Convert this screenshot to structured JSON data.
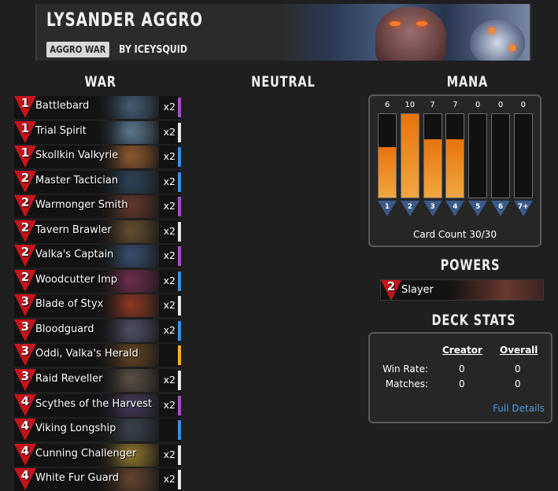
{
  "header": {
    "title": "LYSANDER AGGRO",
    "tag": "AGGRO WAR",
    "author": "BY ICEYSQUID"
  },
  "sections": {
    "war": "WAR",
    "neutral": "NEUTRAL",
    "mana": "MANA",
    "powers": "POWERS",
    "deck_stats": "DECK STATS"
  },
  "cards": [
    {
      "cost": "1",
      "name": "Battlebard",
      "count": "x2",
      "rarity_color": "#a64fc4",
      "art_color": "#5b7fa0"
    },
    {
      "cost": "1",
      "name": "Trial Spirit",
      "count": "x2",
      "rarity_color": "#e8e8e8",
      "art_color": "#7ba6c8"
    },
    {
      "cost": "1",
      "name": "Skollkin Valkyrie",
      "count": "x2",
      "rarity_color": "#3a8de0",
      "art_color": "#c87a3a"
    },
    {
      "cost": "2",
      "name": "Master Tactician",
      "count": "x2",
      "rarity_color": "#3a8de0",
      "art_color": "#3a5a78"
    },
    {
      "cost": "2",
      "name": "Warmonger Smith",
      "count": "x2",
      "rarity_color": "#a64fc4",
      "art_color": "#8a4a3a"
    },
    {
      "cost": "2",
      "name": "Tavern Brawler",
      "count": "x2",
      "rarity_color": "#e8e8e8",
      "art_color": "#8a6a3a"
    },
    {
      "cost": "2",
      "name": "Valka's Captain",
      "count": "x2",
      "rarity_color": "#a64fc4",
      "art_color": "#4a6a9a"
    },
    {
      "cost": "2",
      "name": "Woodcutter Imp",
      "count": "x2",
      "rarity_color": "#3a8de0",
      "art_color": "#9a3a6a"
    },
    {
      "cost": "3",
      "name": "Blade of Styx",
      "count": "x2",
      "rarity_color": "#e8e8e8",
      "art_color": "#c84a2a"
    },
    {
      "cost": "3",
      "name": "Bloodguard",
      "count": "x2",
      "rarity_color": "#3a8de0",
      "art_color": "#6a6a8a"
    },
    {
      "cost": "3",
      "name": "Oddi, Valka's Herald",
      "count": "",
      "rarity_color": "#f0b020",
      "art_color": "#8a5a2a"
    },
    {
      "cost": "3",
      "name": "Raid Reveller",
      "count": "x2",
      "rarity_color": "#e8e8e8",
      "art_color": "#7a6a5a"
    },
    {
      "cost": "4",
      "name": "Scythes of the Harvest",
      "count": "x2",
      "rarity_color": "#a64fc4",
      "art_color": "#5a4a7a"
    },
    {
      "cost": "4",
      "name": "Viking Longship",
      "count": "",
      "rarity_color": "#3a8de0",
      "art_color": "#4a5a6a"
    },
    {
      "cost": "4",
      "name": "Cunning Challenger",
      "count": "x2",
      "rarity_color": "#e8e8e8",
      "art_color": "#c8a23a"
    },
    {
      "cost": "4",
      "name": "White Fur Guard",
      "count": "x2",
      "rarity_color": "#e8e8e8",
      "art_color": "#8a5a3a"
    }
  ],
  "mana": {
    "counts": [
      "6",
      "10",
      "7",
      "7",
      "0",
      "0",
      "0"
    ],
    "levels": [
      0.6,
      1.0,
      0.7,
      0.7,
      0,
      0,
      0
    ],
    "labels": [
      "1",
      "2",
      "3",
      "4",
      "5",
      "6",
      "7+"
    ],
    "card_count": "Card Count 30/30"
  },
  "power": {
    "cost": "2",
    "name": "Slayer"
  },
  "stats": {
    "col_creator": "Creator",
    "col_overall": "Overall",
    "rows": [
      {
        "label": "Win Rate:",
        "creator": "0",
        "overall": "0"
      },
      {
        "label": "Matches:",
        "creator": "0",
        "overall": "0"
      }
    ],
    "link": "Full Details"
  }
}
